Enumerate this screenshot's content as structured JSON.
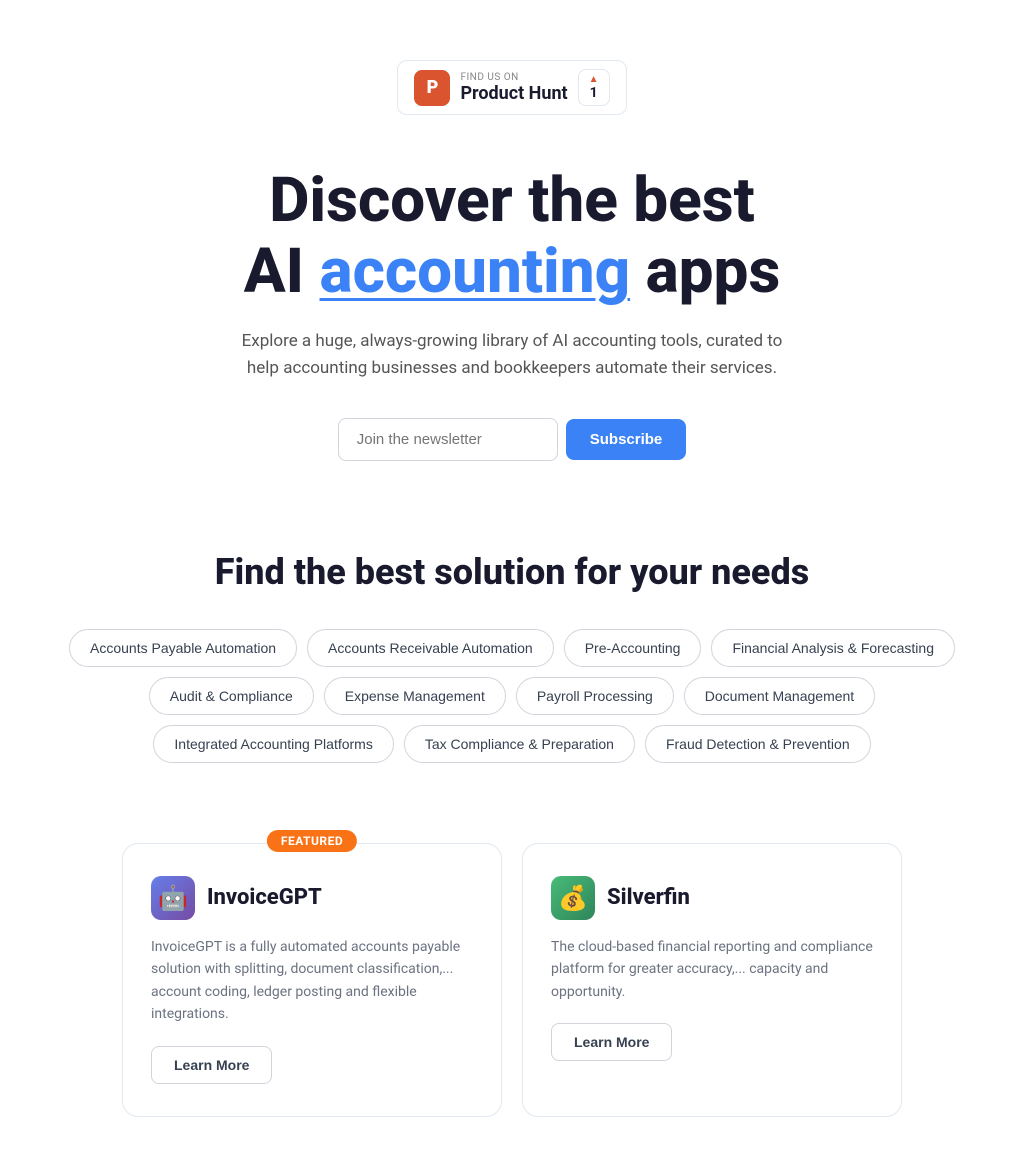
{
  "product_hunt": {
    "find_us_label": "FIND US ON",
    "name": "Product Hunt",
    "vote_count": "1",
    "logo_letter": "P"
  },
  "hero": {
    "title_line1": "Discover the best",
    "title_line2_before": "AI ",
    "title_highlight": "accounting",
    "title_line2_after": " apps",
    "subtitle": "Explore a huge, always-growing library of AI accounting tools, curated to help accounting businesses and bookkeepers automate their services.",
    "newsletter_placeholder": "Join the newsletter",
    "subscribe_label": "Subscribe"
  },
  "solutions": {
    "title": "Find the best solution for your needs",
    "tags": [
      "Accounts Payable Automation",
      "Accounts Receivable Automation",
      "Pre-Accounting",
      "Financial Analysis & Forecasting",
      "Audit & Compliance",
      "Expense Management",
      "Payroll Processing",
      "Document Management",
      "Integrated Accounting Platforms",
      "Tax Compliance & Preparation",
      "Fraud Detection & Prevention"
    ]
  },
  "cards": [
    {
      "featured": true,
      "featured_label": "Featured",
      "logo_emoji": "🤖",
      "title": "InvoiceGPT",
      "description": "InvoiceGPT is a fully automated accounts payable solution with splitting, document classification,... account coding, ledger posting and flexible integrations.",
      "cta": "Learn More"
    },
    {
      "featured": false,
      "logo_emoji": "💰",
      "title": "Silverfin",
      "description": "The cloud-based financial reporting and compliance platform for greater accuracy,... capacity and opportunity.",
      "cta": "Learn More"
    }
  ]
}
